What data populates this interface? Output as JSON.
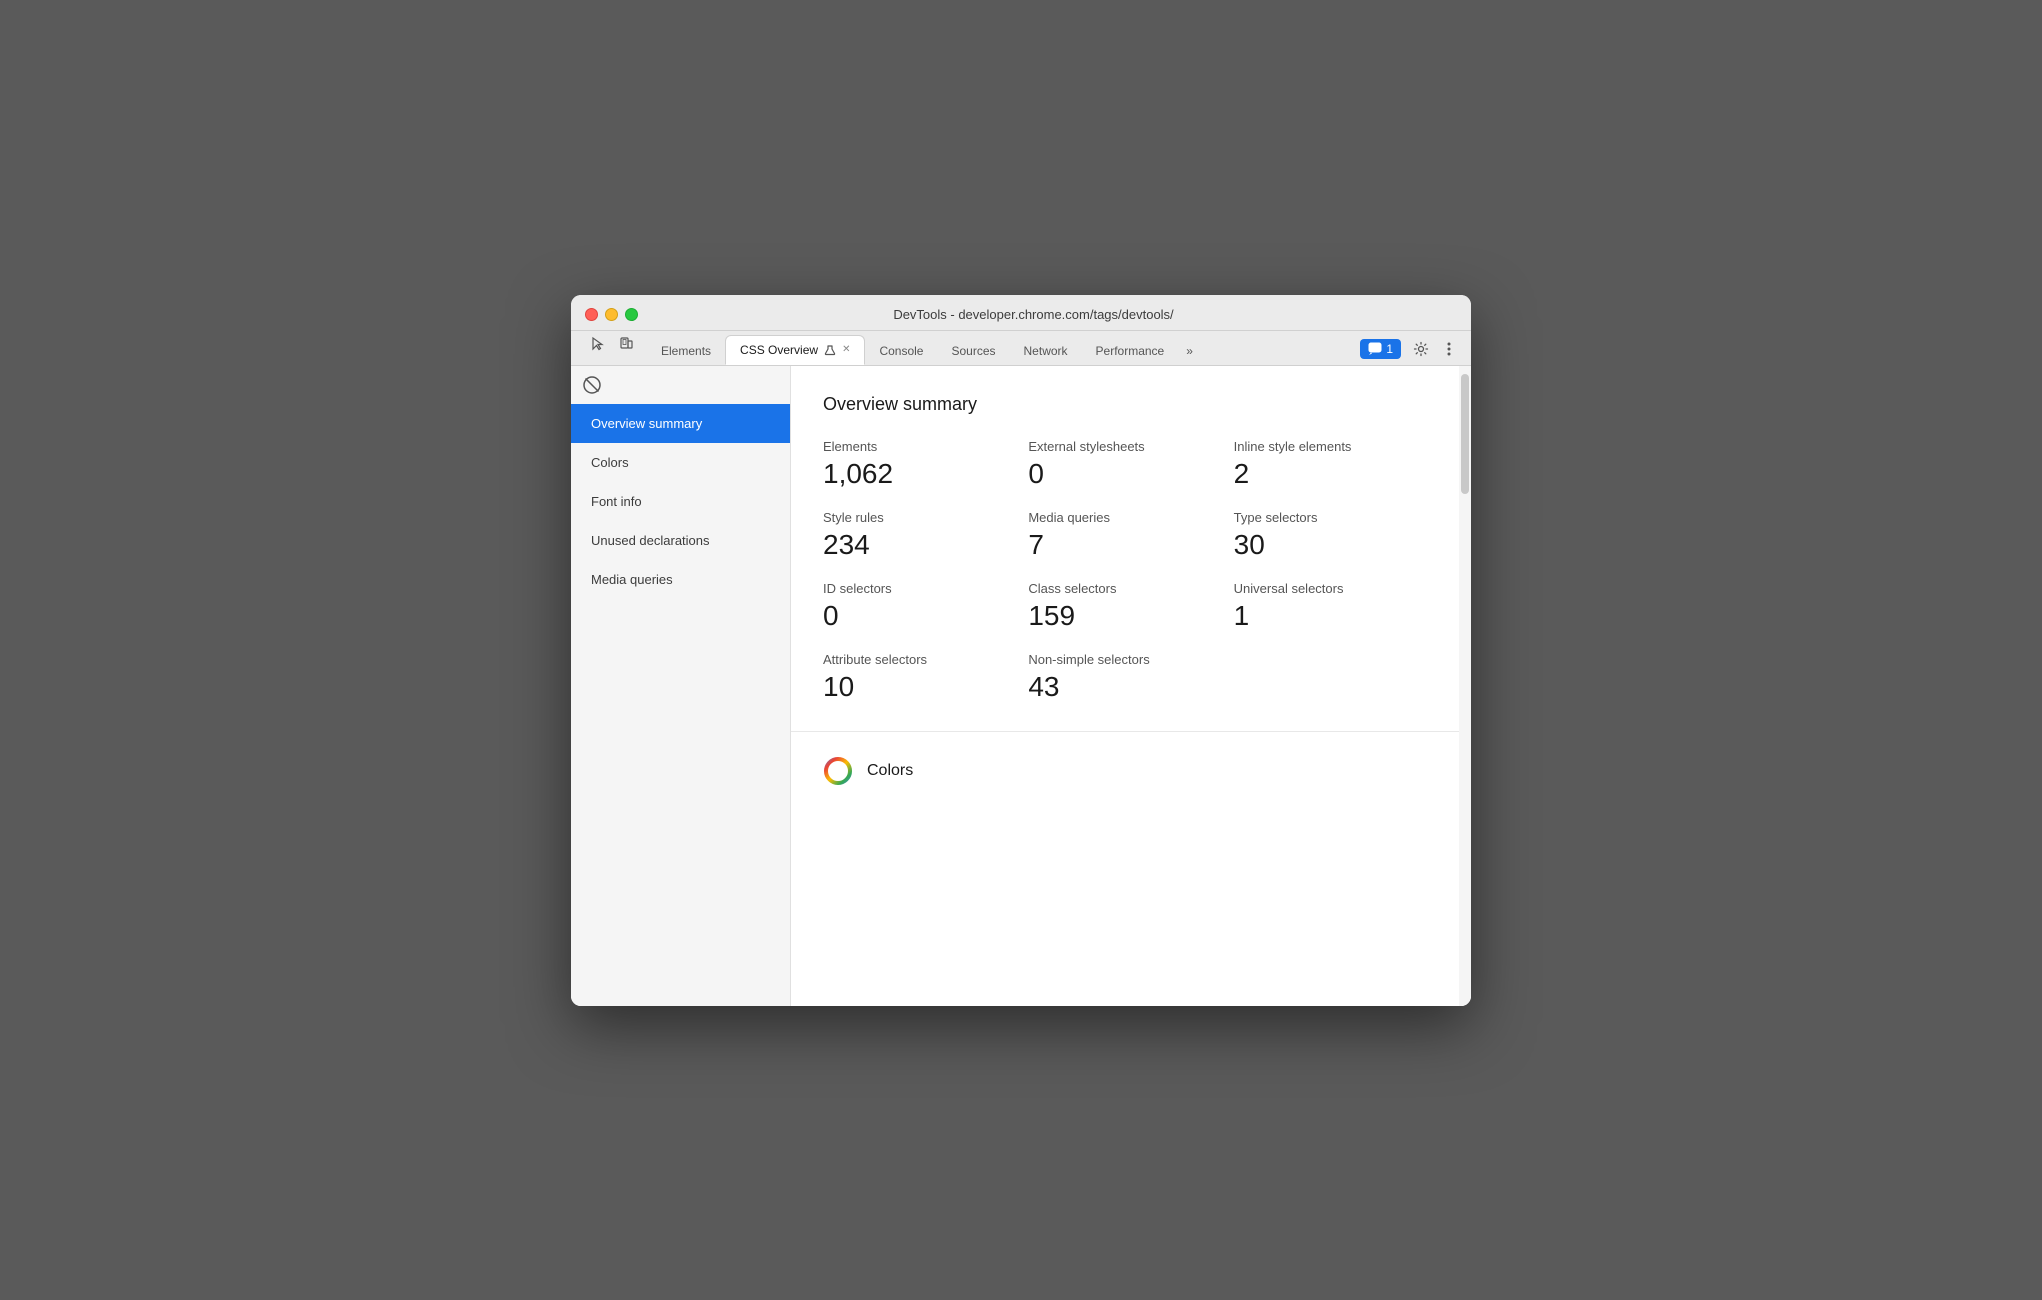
{
  "window": {
    "title": "DevTools - developer.chrome.com/tags/devtools/"
  },
  "tabs": [
    {
      "id": "elements",
      "label": "Elements",
      "active": false,
      "closeable": false
    },
    {
      "id": "css-overview",
      "label": "CSS Overview",
      "active": true,
      "closeable": true,
      "has_icon": true
    },
    {
      "id": "console",
      "label": "Console",
      "active": false,
      "closeable": false
    },
    {
      "id": "sources",
      "label": "Sources",
      "active": false,
      "closeable": false
    },
    {
      "id": "network",
      "label": "Network",
      "active": false,
      "closeable": false
    },
    {
      "id": "performance",
      "label": "Performance",
      "active": false,
      "closeable": false
    }
  ],
  "tabs_more_label": "»",
  "notification_count": "1",
  "sidebar": {
    "items": [
      {
        "id": "overview-summary",
        "label": "Overview summary",
        "active": true
      },
      {
        "id": "colors",
        "label": "Colors",
        "active": false
      },
      {
        "id": "font-info",
        "label": "Font info",
        "active": false
      },
      {
        "id": "unused-declarations",
        "label": "Unused declarations",
        "active": false
      },
      {
        "id": "media-queries",
        "label": "Media queries",
        "active": false
      }
    ]
  },
  "main": {
    "overview": {
      "title": "Overview summary",
      "stats": [
        {
          "id": "elements",
          "label": "Elements",
          "value": "1,062"
        },
        {
          "id": "external-stylesheets",
          "label": "External stylesheets",
          "value": "0"
        },
        {
          "id": "inline-style-elements",
          "label": "Inline style elements",
          "value": "2"
        },
        {
          "id": "style-rules",
          "label": "Style rules",
          "value": "234"
        },
        {
          "id": "media-queries",
          "label": "Media queries",
          "value": "7"
        },
        {
          "id": "type-selectors",
          "label": "Type selectors",
          "value": "30"
        },
        {
          "id": "id-selectors",
          "label": "ID selectors",
          "value": "0"
        },
        {
          "id": "class-selectors",
          "label": "Class selectors",
          "value": "159"
        },
        {
          "id": "universal-selectors",
          "label": "Universal selectors",
          "value": "1"
        },
        {
          "id": "attribute-selectors",
          "label": "Attribute selectors",
          "value": "10"
        },
        {
          "id": "non-simple-selectors",
          "label": "Non-simple selectors",
          "value": "43"
        }
      ]
    },
    "colors_section": {
      "title": "Colors"
    }
  },
  "icons": {
    "cursor": "⬚",
    "layers": "⧉",
    "block": "⊘",
    "gear": "⚙",
    "more": "⋮"
  }
}
